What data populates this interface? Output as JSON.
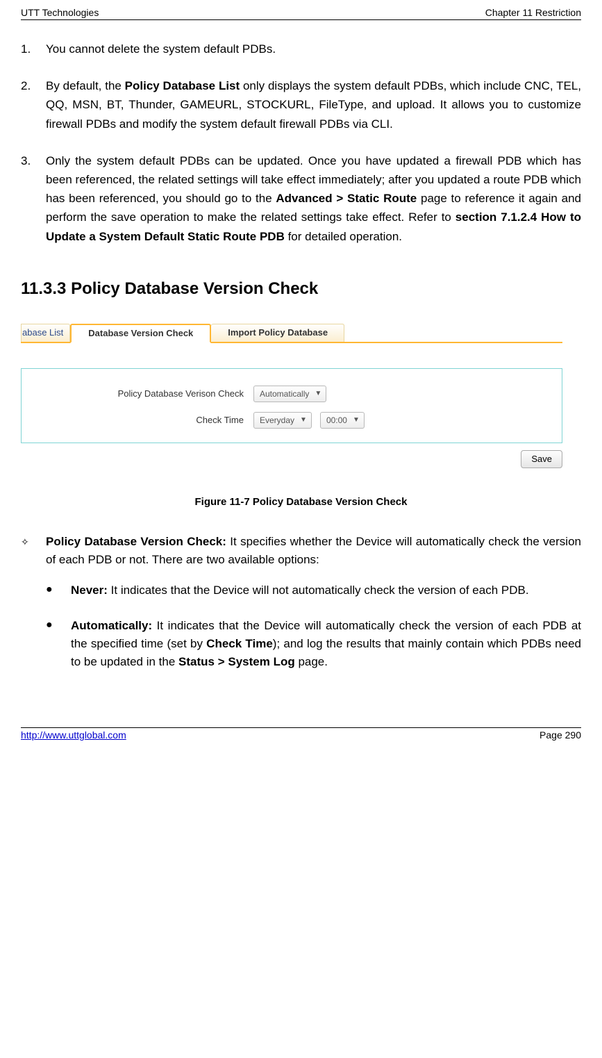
{
  "header": {
    "left": "UTT Technologies",
    "right": "Chapter 11 Restriction"
  },
  "items": {
    "n1": {
      "num": "1.",
      "text": "You cannot delete the system default PDBs."
    },
    "n2": {
      "num": "2.",
      "pre": "By default, the ",
      "bold1": "Policy Database List",
      "post": " only displays the system default PDBs, which include CNC, TEL, QQ, MSN, BT, Thunder, GAMEURL, STOCKURL, FileType, and upload. It allows you to customize firewall PDBs and modify the system default firewall PDBs via CLI."
    },
    "n3": {
      "num": "3.",
      "p1": "Only the system default PDBs can be updated. Once you have updated a firewall PDB which has been referenced, the related settings will take effect immediately; after you updated a route PDB which has been referenced, you should go to the ",
      "b1": "Advanced > Static Route",
      "p2": " page to reference it again and perform the save operation to make the related settings take effect. Refer to ",
      "b2": "section 7.1.2.4 How to Update a System Default Static Route PDB",
      "p3": " for detailed operation."
    }
  },
  "section_title": "11.3.3  Policy Database Version Check",
  "ui": {
    "tabs": {
      "partial": "abase List",
      "active": "Database Version Check",
      "next": "Import Policy Database"
    },
    "labels": {
      "version": "Policy Database Verison Check",
      "time": "Check Time"
    },
    "selects": {
      "mode": "Automatically",
      "day": "Everyday",
      "hour": "00:00"
    },
    "save": "Save"
  },
  "caption": "Figure 11-7 Policy Database Version Check",
  "dia": {
    "title": "Policy Database Version Check:",
    "text": " It specifies whether the Device will automatically check the version of each PDB or not. There are two available options:"
  },
  "bul1": {
    "title": "Never:",
    "text": " It indicates that the Device will not automatically check the version of each PDB."
  },
  "bul2": {
    "title": "Automatically:",
    "t1": " It indicates that the Device will automatically check the version of each PDB at the specified time (set by ",
    "b1": "Check Time",
    "t2": "); and log the results that mainly contain which PDBs need to be updated in the ",
    "b2": "Status > System Log",
    "t3": " page."
  },
  "footer": {
    "url": "http://www.uttglobal.com",
    "page": "Page 290"
  }
}
